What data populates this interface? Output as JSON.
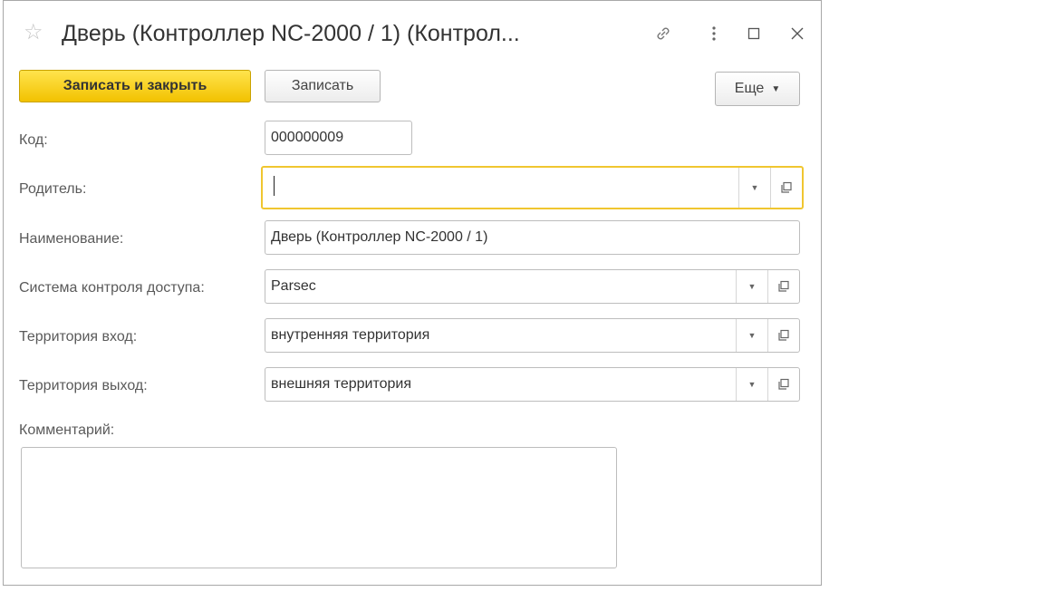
{
  "window": {
    "title": "Дверь (Контроллер NC-2000 / 1) (Контрол...",
    "icons": [
      "star-icon",
      "link-icon",
      "more-vertical-icon",
      "maximize-icon",
      "close-icon"
    ]
  },
  "toolbar": {
    "save_close_label": "Записать и закрыть",
    "save_label": "Записать",
    "more_label": "Еще"
  },
  "form": {
    "code": {
      "label": "Код:",
      "value": "000000009"
    },
    "parent": {
      "label": "Родитель:",
      "value": ""
    },
    "name": {
      "label": "Наименование:",
      "value": "Дверь (Контроллер NC-2000 / 1)"
    },
    "access_system": {
      "label": "Система контроля доступа:",
      "value": "Parsec"
    },
    "territory_in": {
      "label": "Территория вход:",
      "value": "внутренняя территория"
    },
    "territory_out": {
      "label": "Территория выход:",
      "value": "внешняя территория"
    },
    "comment": {
      "label": "Комментарий:",
      "value": ""
    }
  },
  "colors": {
    "primary_button": "#f5c800",
    "active_field_border": "#f0c630"
  }
}
